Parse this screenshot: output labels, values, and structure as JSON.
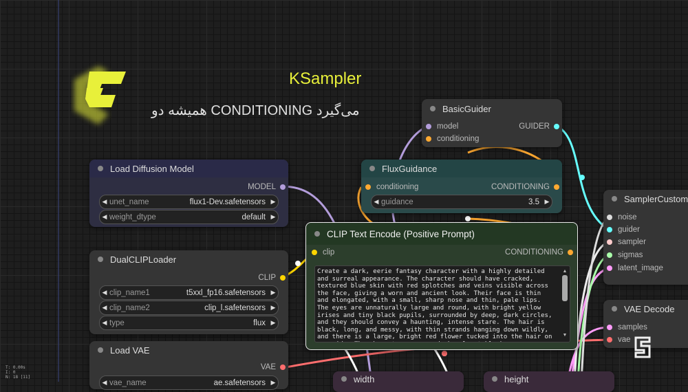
{
  "overlay": {
    "title": "KSampler",
    "subtitle": "همیشه دو CONDITIONING می‌گیرد"
  },
  "colors": {
    "accent_yellow": "#e8f03a",
    "model_pin": "#b39ddb",
    "cond_pin": "#ffa931",
    "clip_pin": "#ffd500",
    "guider_pin": "#66ffff",
    "vae_pin": "#ff6e6e",
    "latent_pin": "#ff9cf9"
  },
  "nodes": {
    "basic_guider": {
      "title": "BasicGuider",
      "inputs": [
        "model",
        "conditioning"
      ],
      "output": "GUIDER"
    },
    "load_diffusion": {
      "title": "Load Diffusion Model",
      "output": "MODEL",
      "widgets": [
        {
          "label": "unet_name",
          "value": "flux1-Dev.safetensors"
        },
        {
          "label": "weight_dtype",
          "value": "default"
        }
      ]
    },
    "flux_guidance": {
      "title": "FluxGuidance",
      "input": "conditioning",
      "output": "CONDITIONING",
      "widget": {
        "label": "guidance",
        "value": "3.5"
      }
    },
    "clip_text_encode": {
      "title": "CLIP Text Encode (Positive Prompt)",
      "input": "clip",
      "output": "CONDITIONING",
      "prompt": "Create a dark, eerie fantasy character with a highly detailed and surreal appearance. The character should have cracked, textured blue skin with red splotches and veins visible across the face, giving a worn and ancient look. Their face is thin and elongated, with a small, sharp nose and thin, pale lips. The eyes are unnaturally large and round, with bright yellow irises and tiny black pupils, surrounded by deep, dark circles, and they should convey a haunting, intense stare. The hair is black, long, and messy, with thin strands hanging down wildly, and there is a large, bright red flower tucked into the hair on one side. The character wears a dark, almost black"
    },
    "dual_clip": {
      "title": "DualCLIPLoader",
      "output": "CLIP",
      "widgets": [
        {
          "label": "clip_name1",
          "value": "t5xxl_fp16.safetensors"
        },
        {
          "label": "clip_name2",
          "value": "clip_l.safetensors"
        },
        {
          "label": "type",
          "value": "flux"
        }
      ]
    },
    "load_vae": {
      "title": "Load VAE",
      "output": "VAE",
      "widget": {
        "label": "vae_name",
        "value": "ae.safetensors"
      }
    },
    "sampler_custom": {
      "title": "SamplerCustomA",
      "inputs": [
        "noise",
        "guider",
        "sampler",
        "sigmas",
        "latent_image"
      ]
    },
    "vae_decode": {
      "title": "VAE Decode",
      "inputs": [
        "samples",
        "vae"
      ]
    },
    "width": {
      "title": "width"
    },
    "height": {
      "title": "height"
    }
  },
  "stats": {
    "line1": "T: 0.00s",
    "line2": "I: 0",
    "line3": "N: 18 [11]"
  }
}
